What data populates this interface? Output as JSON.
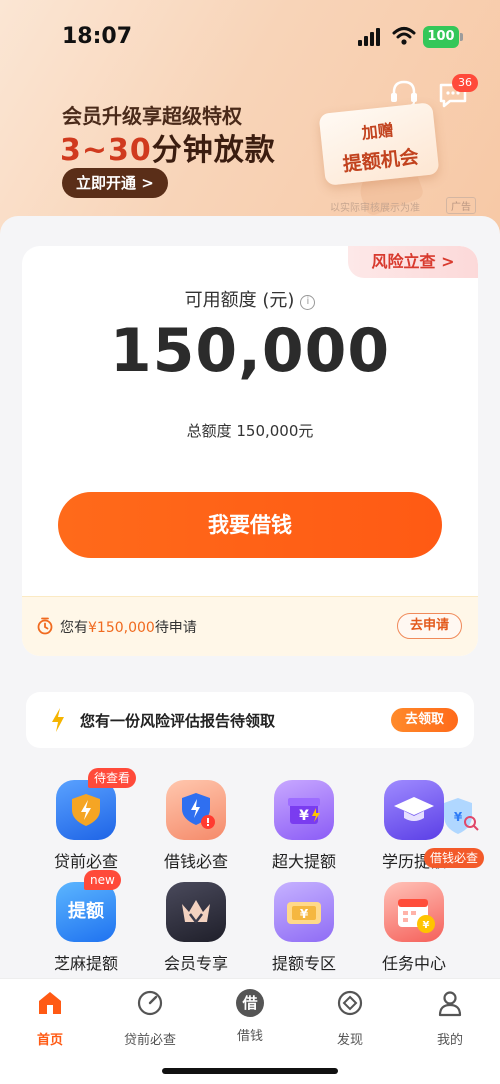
{
  "status_bar": {
    "time": "18:07",
    "battery": "100"
  },
  "banner": {
    "subtitle": "会员升级享超级特权",
    "title_highlight": "3~30",
    "title_rest": "分钟放款",
    "open_button": "立即开通 >",
    "message_badge": "36",
    "promo_line1": "加赠",
    "promo_line2": "提额机会",
    "ad_note": "以实际审核展示为准",
    "ad_tag": "广告"
  },
  "credit": {
    "risk_tag": "风险立查 >",
    "available_label": "可用额度 (元)",
    "info_symbol": "i",
    "available_amount": "150,000",
    "total_text": "总额度 150,000元",
    "borrow_button": "我要借钱",
    "pending_prefix": "您有",
    "pending_amount": "¥150,000",
    "pending_suffix": "待申请",
    "apply_button": "去申请"
  },
  "report": {
    "text": "您有一份风险评估报告待领取",
    "claim_button": "去领取"
  },
  "services": [
    {
      "label": "贷前必查",
      "badge": "待查看",
      "icon": "shield-bolt-icon",
      "color": "#2f7cf6"
    },
    {
      "label": "借钱必查",
      "badge": "",
      "icon": "shield-alert-icon",
      "color": "#f58a6a"
    },
    {
      "label": "超大提额",
      "badge": "",
      "icon": "gift-yen-icon",
      "color": "#8b5cf6"
    },
    {
      "label": "学历提额",
      "badge": "借钱必查",
      "icon": "graduation-cap-icon",
      "color": "#6d4ef2"
    },
    {
      "label": "芝麻提额",
      "badge": "new",
      "icon": "sesame-boost-icon",
      "color": "#2f8af6",
      "glyph": "提额"
    },
    {
      "label": "会员专享",
      "badge": "",
      "icon": "crown-icon",
      "color": "#3a3a4a"
    },
    {
      "label": "提额专区",
      "badge": "",
      "icon": "ticket-yen-icon",
      "color": "#9b7cf5"
    },
    {
      "label": "任务中心",
      "badge": "",
      "icon": "calendar-coin-icon",
      "color": "#f5605a"
    }
  ],
  "tabbar": [
    {
      "label": "首页",
      "icon": "home-icon",
      "active": true
    },
    {
      "label": "贷前必查",
      "icon": "gauge-icon",
      "active": false
    },
    {
      "label": "借钱",
      "icon": "borrow-icon",
      "active": false,
      "glyph": "借"
    },
    {
      "label": "发现",
      "icon": "discover-icon",
      "active": false
    },
    {
      "label": "我的",
      "icon": "profile-icon",
      "active": false
    }
  ]
}
